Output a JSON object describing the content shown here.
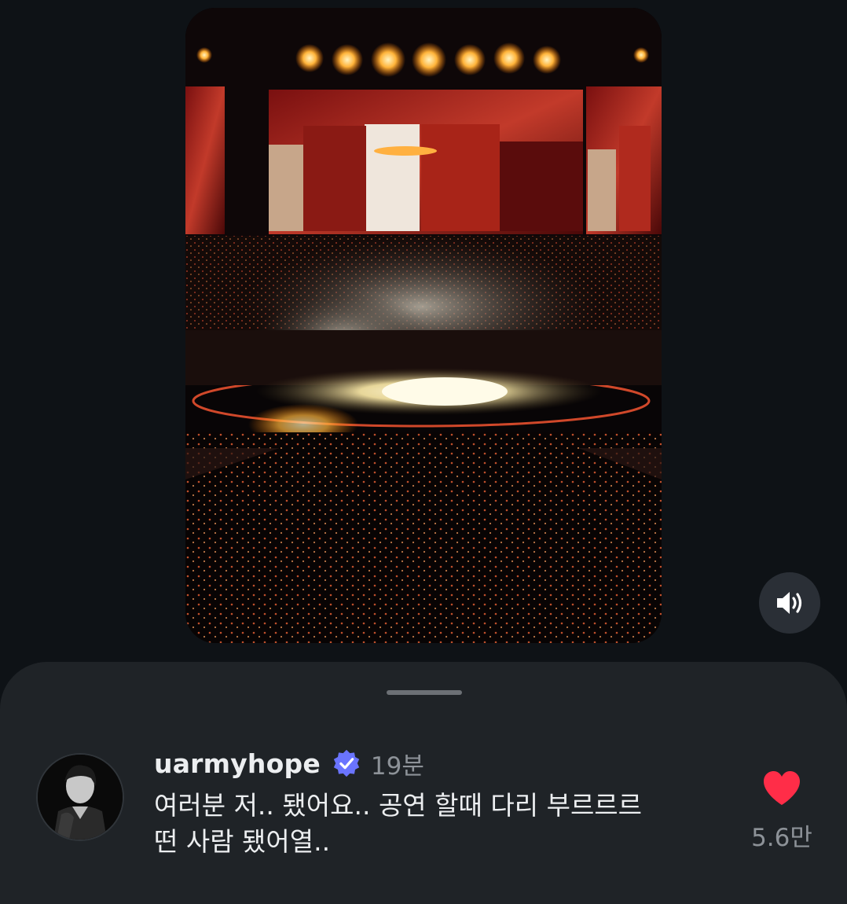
{
  "post": {
    "media": {
      "icon": "concert-photo"
    },
    "sound_button": {
      "icon": "speaker-volume-icon"
    }
  },
  "comment": {
    "username": "uarmyhope",
    "verified_icon": "verified-badge-icon",
    "time": "19분",
    "text_line1": "여러분 저.. 됐어요.. 공연 할때 다리 부르르르",
    "text_line2": "떤 사람 됐어열..",
    "likes": "5.6만",
    "like_icon": "heart-icon"
  },
  "colors": {
    "background": "#0e1216",
    "sheet": "#1f2327",
    "heart": "#ff2d48",
    "verified": "#6a74ff",
    "muted_text": "#8d9298"
  }
}
